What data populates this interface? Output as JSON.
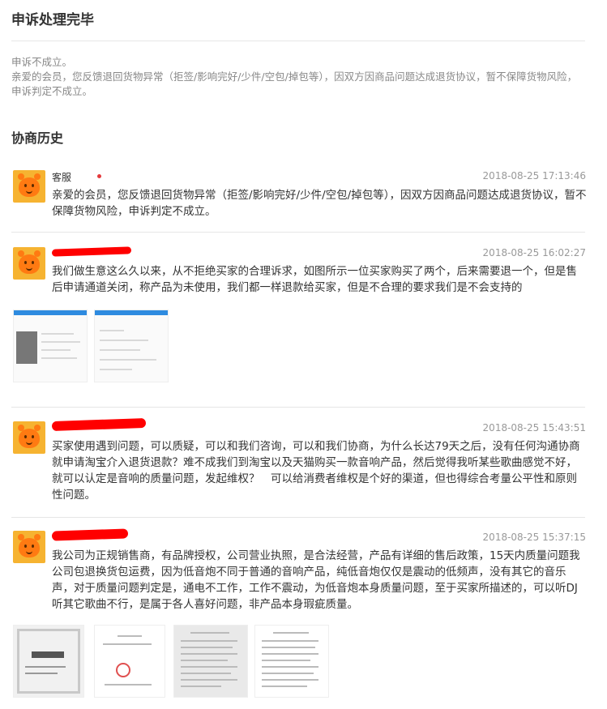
{
  "header": {
    "title": "申诉处理完毕"
  },
  "result": {
    "status": "申诉不成立。",
    "detail": "亲爱的会员，您反馈退回货物异常（拒签/影响完好/少件/空包/掉包等），因双方因商品问题达成退货协议，暂不保障货物风险，申诉判定不成立。"
  },
  "history": {
    "title": "协商历史",
    "messages": [
      {
        "sender": "客服",
        "time": "2018-08-25 17:13:46",
        "text": "亲爱的会员，您反馈退回货物异常（拒签/影响完好/少件/空包/掉包等），因双方因商品问题达成退货协议，暂不保障货物风险，申诉判定不成立。"
      },
      {
        "sender": "",
        "time": "2018-08-25 16:02:27",
        "text": "我们做生意这么久以来，从不拒绝买家的合理诉求，如图所示一位买家购买了两个，后来需要退一个，但是售后申请通道关闭，称产品为未使用，我们都一样退款给买家，但是不合理的要求我们是不会支持的"
      },
      {
        "sender": "",
        "time": "2018-08-25 15:43:51",
        "text": "买家使用遇到问题，可以质疑，可以和我们咨询，可以和我们协商，为什么长达79天之后，没有任何沟通协商就申请淘宝介入退货退款？难不成我们到淘宝以及天猫购买一款音响产品，然后觉得我听某些歌曲感觉不好，就可以认定是音响的质量问题，发起维权？　可以给消费者维权是个好的渠道，但也得综合考量公平性和原则性问题。"
      },
      {
        "sender": "",
        "time": "2018-08-25 15:37:15",
        "text": "我公司为正规销售商，有品牌授权，公司营业执照，是合法经营，产品有详细的售后政策，15天内质量问题我公司包退换货包运费，因为低音炮不同于普通的音响产品，纯低音炮仅仅是震动的低频声，没有其它的音乐声，对于质量问题判定是，通电不工作，工作不震动，为低音炮本身质量问题，至于买家所描述的，可以听DJ 听其它歌曲不行，是属于各人喜好问题，非产品本身瑕疵质量。"
      }
    ]
  }
}
